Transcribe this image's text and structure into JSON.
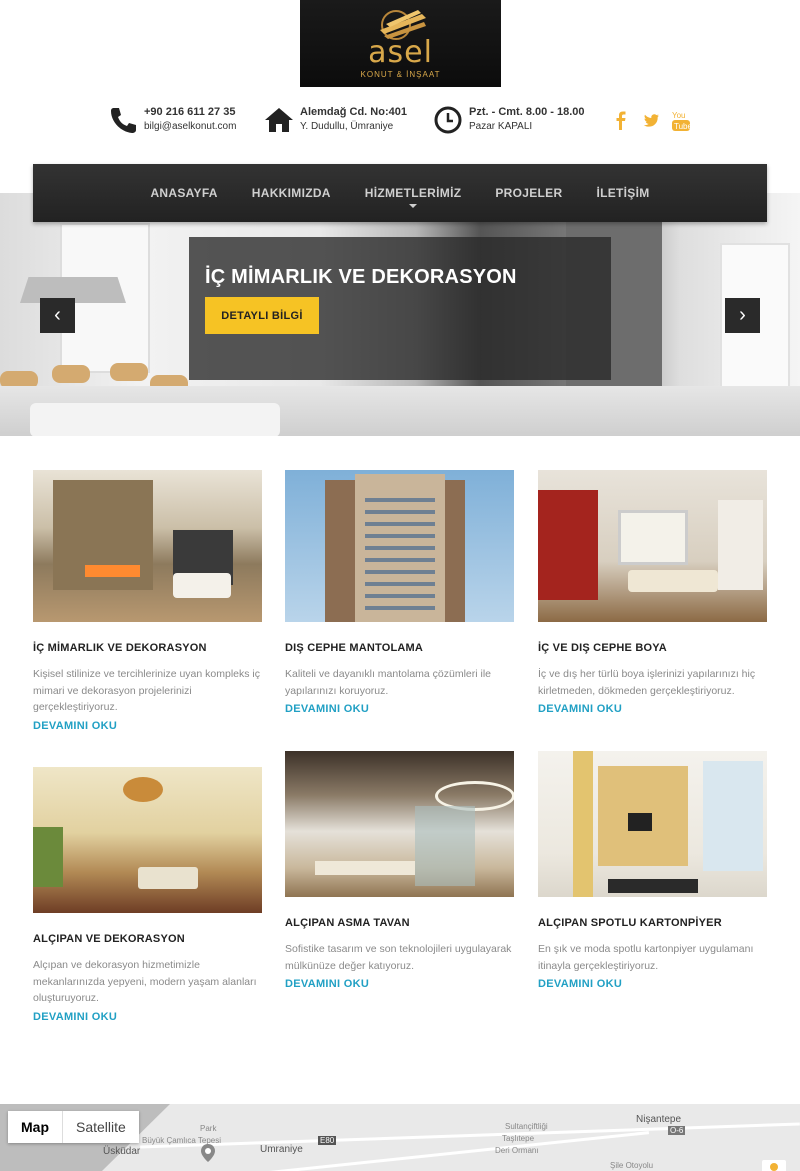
{
  "brand": {
    "name": "asel",
    "tagline": "KONUT & İNŞAAT"
  },
  "contact": {
    "phone": "+90 216 611 27 35",
    "email": "bilgi@aselkonut.com",
    "address_line1": "Alemdağ Cd. No:401",
    "address_line2": "Y. Dudullu, Ümraniye",
    "hours_line1": "Pzt. - Cmt. 8.00 - 18.00",
    "hours_line2": "Pazar KAPALI"
  },
  "social": [
    "facebook-icon",
    "twitter-icon",
    "youtube-icon"
  ],
  "colors": {
    "accent": "#f6c324",
    "link": "#21a0c4",
    "nav_bg": "#2a2a2a",
    "social": "#f2b234"
  },
  "nav": {
    "items": [
      {
        "label": "ANASAYFA"
      },
      {
        "label": "HAKKIMIZDA"
      },
      {
        "label": "HİZMETLERİMİZ",
        "has_dropdown": true
      },
      {
        "label": "PROJELER"
      },
      {
        "label": "İLETİŞİM"
      }
    ]
  },
  "hero": {
    "title": "İÇ MİMARLIK VE DEKORASYON",
    "button": "DETAYLI BİLGİ",
    "prev": "‹",
    "next": "›"
  },
  "services": [
    {
      "title": "İÇ MİMARLIK VE DEKORASYON",
      "text": "Kişisel stilinize ve tercihlerinize uyan kompleks iç mimari ve dekorasyon projelerinizi gerçekleştiriyoruz.",
      "link": "DEVAMINI OKU"
    },
    {
      "title": "DIŞ CEPHE MANTOLAMA",
      "text": "Kaliteli ve dayanıklı mantolama çözümleri ile yapılarınızı koruyoruz.",
      "link": "DEVAMINI OKU"
    },
    {
      "title": "İÇ VE DIŞ CEPHE BOYA",
      "text": "İç ve dış her türlü boya işlerinizi yapılarınızı hiç kirletmeden, dökmeden gerçekleştiriyoruz.",
      "link": "DEVAMINI OKU"
    },
    {
      "title": "ALÇIPAN VE DEKORASYON",
      "text": "Alçıpan ve dekorasyon hizmetimizle mekanlarınızda yepyeni, modern yaşam alanları oluşturuyoruz.",
      "link": "DEVAMINI OKU"
    },
    {
      "title": "ALÇIPAN ASMA TAVAN",
      "text": "Sofistike tasarım ve son teknolojileri uygulayarak mülkünüze değer katıyoruz.",
      "link": "DEVAMINI OKU"
    },
    {
      "title": "ALÇIPAN SPOTLU KARTONPİYER",
      "text": "En şık ve moda spotlu kartonpiyer uygulamanı itinayla gerçekleştiriyoruz.",
      "link": "DEVAMINI OKU"
    }
  ],
  "map": {
    "tab_map": "Map",
    "tab_satellite": "Satellite",
    "labels": [
      "Üsküdar",
      "Park",
      "Büyük Çamlıca Tepesi",
      "Umraniye",
      "E80",
      "Sultançiftliği",
      "Taşlıtepe",
      "Deri Ormanı",
      "Nişantepe",
      "O-6",
      "Şile Otoyolu"
    ]
  }
}
